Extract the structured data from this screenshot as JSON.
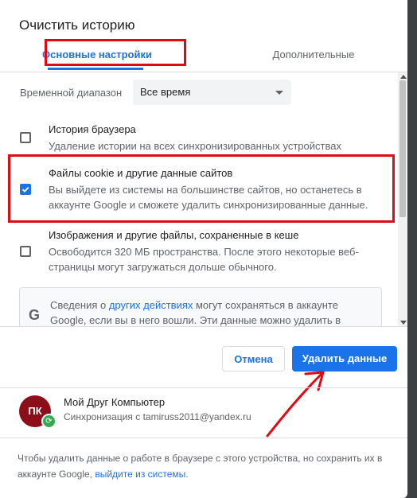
{
  "dialog": {
    "title": "Очистить историю",
    "tabs": [
      {
        "label": "Основные настройки",
        "active": true
      },
      {
        "label": "Дополнительные",
        "active": false
      }
    ]
  },
  "time_range": {
    "label": "Временной диапазон",
    "selected": "Все время"
  },
  "items": [
    {
      "title": "История браузера",
      "description": "Удаление истории на всех синхронизированных устройствах",
      "checked": false
    },
    {
      "title": "Файлы cookie и другие данные сайтов",
      "description": "Вы выйдете из системы на большинстве сайтов, но останетесь в аккаунте Google и сможете удалить синхронизированные данные.",
      "checked": true
    },
    {
      "title": "Изображения и другие файлы, сохраненные в кеше",
      "description": "Освободится 320 МБ пространства. После этого некоторые веб-страницы могут загружаться дольше обычного.",
      "checked": false
    }
  ],
  "google_notice": {
    "before_link": "Сведения о ",
    "link": "других действиях",
    "after_link": " могут сохраняться в аккаунте Google, если вы в него вошли. Эти данные можно удалить в"
  },
  "buttons": {
    "cancel": "Отмена",
    "delete": "Удалить данные"
  },
  "account": {
    "name": "Мой Друг Компьютер",
    "sync": "Синхронизация с tamiruss2011@yandex.ru",
    "avatar_text": "ПК"
  },
  "footer": {
    "text": "Чтобы удалить данные о работе в браузере с этого устройства, но сохранить их в аккаунте Google, ",
    "link": "выйдите из системы",
    "end": "."
  },
  "colors": {
    "accent": "#1a73e8",
    "highlight_red": "#e00a14"
  }
}
